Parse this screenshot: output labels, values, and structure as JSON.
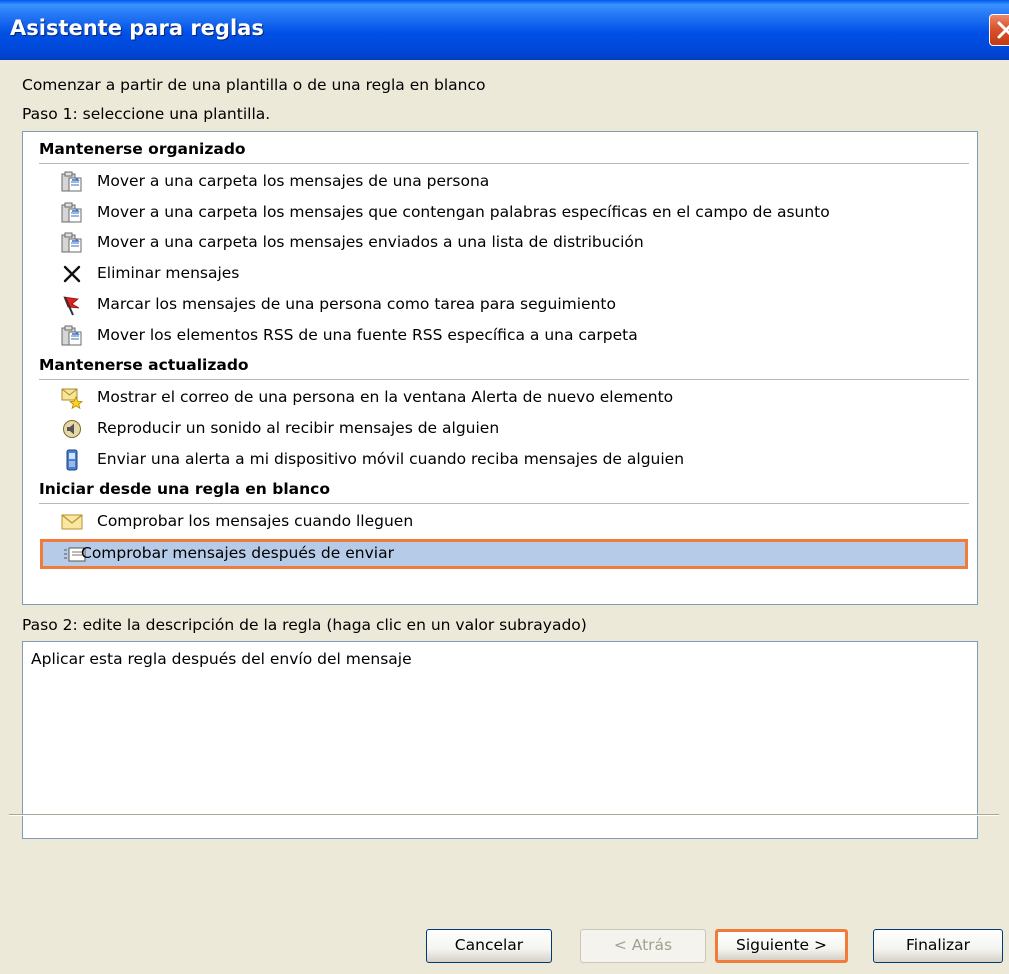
{
  "window": {
    "title": "Asistente para reglas"
  },
  "intro": {
    "line1": "Comenzar a partir de una plantilla o de una regla en blanco",
    "step1": "Paso 1: seleccione una plantilla."
  },
  "sections": [
    {
      "header": "Mantenerse organizado",
      "items": [
        {
          "label": "Mover a una carpeta los mensajes de una persona",
          "icon": "move-to-folder-icon"
        },
        {
          "label": "Mover a una carpeta los mensajes que contengan palabras específicas en el campo de asunto",
          "icon": "move-to-folder-icon"
        },
        {
          "label": "Mover a una carpeta los mensajes enviados a una lista de distribución",
          "icon": "move-to-folder-icon"
        },
        {
          "label": "Eliminar mensajes",
          "icon": "delete-x-icon"
        },
        {
          "label": "Marcar los mensajes de una persona como tarea para seguimiento",
          "icon": "red-flag-icon"
        },
        {
          "label": "Mover los elementos RSS de una fuente RSS específica a una carpeta",
          "icon": "move-to-folder-icon"
        }
      ]
    },
    {
      "header": "Mantenerse actualizado",
      "items": [
        {
          "label": "Mostrar el correo de una persona en la ventana Alerta de nuevo elemento",
          "icon": "alert-star-icon"
        },
        {
          "label": "Reproducir un sonido al recibir mensajes de alguien",
          "icon": "speaker-icon"
        },
        {
          "label": "Enviar una alerta a mi dispositivo móvil cuando reciba mensajes de alguien",
          "icon": "mobile-device-icon"
        }
      ]
    },
    {
      "header": "Iniciar desde una regla en blanco",
      "items": [
        {
          "label": "Comprobar los mensajes cuando lleguen",
          "icon": "envelope-icon"
        },
        {
          "label": "Comprobar mensajes después de enviar",
          "icon": "send-message-icon",
          "selected": true
        }
      ]
    }
  ],
  "step2": {
    "label": "Paso 2: edite la descripción de la regla (haga clic en un valor subrayado)",
    "description": "Aplicar esta regla después del envío del mensaje"
  },
  "buttons": {
    "cancel": "Cancelar",
    "back": "< Atrás",
    "next": "Siguiente >",
    "finish": "Finalizar"
  },
  "colors": {
    "accent_highlight": "#f07b3a",
    "selection": "#b6cbe8",
    "titlebar": "#0050e6"
  }
}
